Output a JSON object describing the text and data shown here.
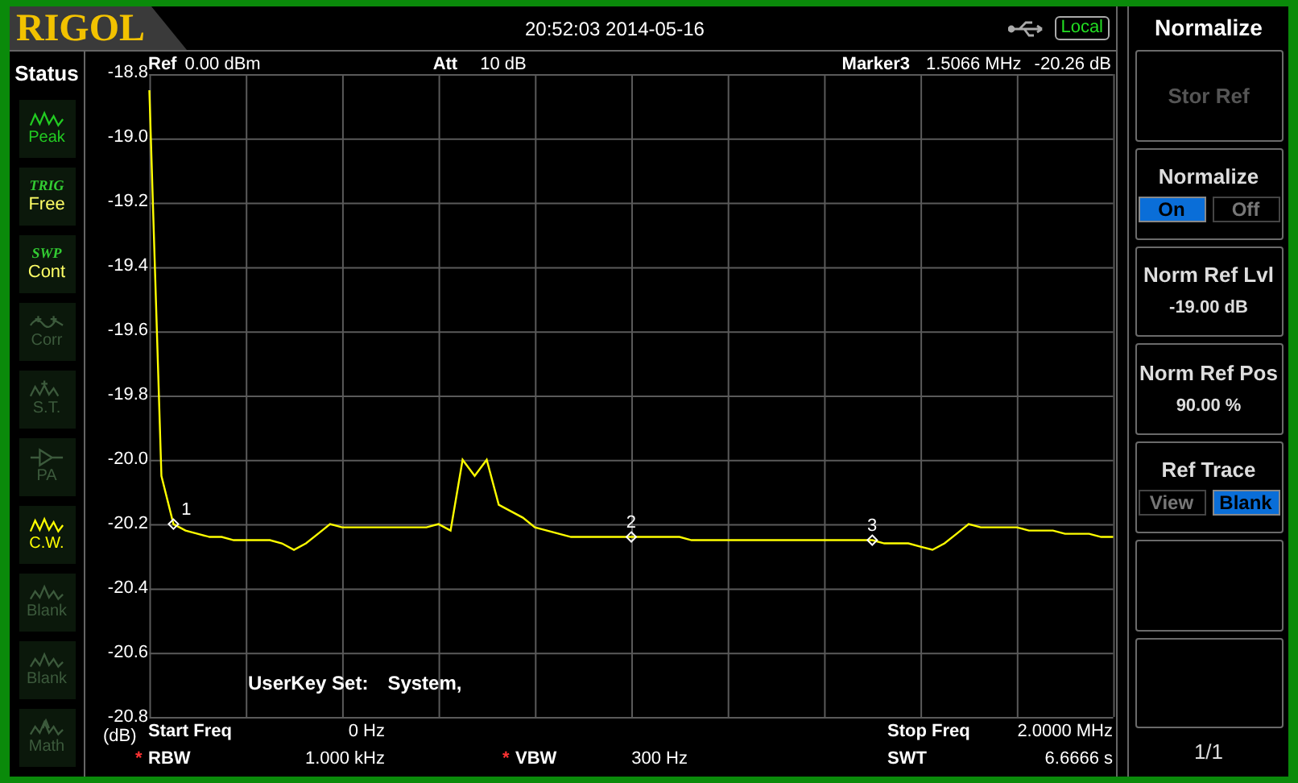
{
  "header": {
    "logo": "RIGOL",
    "datetime": "20:52:03 2014-05-16",
    "remote_badge": "Local"
  },
  "status_panel": {
    "title": "Status",
    "items": [
      {
        "kind": "icon",
        "label": "Peak",
        "disabled": false,
        "selected": false
      },
      {
        "kind": "text",
        "heading": "TRIG",
        "value": "Free"
      },
      {
        "kind": "text",
        "heading": "SWP",
        "value": "Cont"
      },
      {
        "kind": "icon",
        "label": "Corr",
        "disabled": true,
        "selected": false
      },
      {
        "kind": "icon",
        "label": "S.T.",
        "disabled": true,
        "selected": false
      },
      {
        "kind": "icon",
        "label": "PA",
        "disabled": true,
        "selected": false
      },
      {
        "kind": "icon",
        "label": "C.W.",
        "disabled": false,
        "selected": true
      },
      {
        "kind": "icon",
        "label": "Blank",
        "disabled": true,
        "selected": false
      },
      {
        "kind": "icon",
        "label": "Blank",
        "disabled": true,
        "selected": false
      },
      {
        "kind": "icon",
        "label": "Math",
        "disabled": true,
        "selected": false
      }
    ]
  },
  "trace_header": {
    "ref_label": "Ref",
    "ref_value": "0.00 dBm",
    "att_label": "Att",
    "att_value": "10 dB",
    "marker_label": "Marker3",
    "marker_freq": "1.5066 MHz",
    "marker_level": "-20.26 dB"
  },
  "plot": {
    "userkey_label": "UserKey Set:",
    "userkey_value": "System,",
    "markers": [
      {
        "text": "1"
      },
      {
        "text": "2"
      },
      {
        "text": "3"
      }
    ],
    "chart_data": {
      "type": "line",
      "ylabel": "(dB)",
      "grid": true,
      "ylim": [
        -20.8,
        -18.8
      ],
      "yticks": [
        {
          "value": -18.8,
          "label": "-18.8"
        },
        {
          "value": -19,
          "label": "-19.0"
        },
        {
          "value": -19.2,
          "label": "-19.2"
        },
        {
          "value": -19.4,
          "label": "-19.4"
        },
        {
          "value": -19.6,
          "label": "-19.6"
        },
        {
          "value": -19.8,
          "label": "-19.8"
        },
        {
          "value": -20,
          "label": "-20.0"
        },
        {
          "value": -20.2,
          "label": "-20.2"
        },
        {
          "value": -20.4,
          "label": "-20.4"
        },
        {
          "value": -20.6,
          "label": "-20.6"
        },
        {
          "value": -20.8,
          "label": "-20.8"
        }
      ],
      "categories": [
        null,
        null,
        null,
        null,
        null,
        null,
        null,
        null,
        null,
        null,
        null,
        null,
        null,
        null,
        null,
        null,
        null,
        null,
        null,
        null,
        null,
        null,
        null,
        null,
        null,
        null,
        null,
        null,
        null,
        null,
        null,
        null,
        null,
        null,
        null,
        null,
        null,
        null,
        null,
        null,
        null,
        null,
        null,
        null,
        null,
        null,
        null,
        null,
        null,
        null,
        null,
        null,
        null,
        null,
        null,
        null,
        null,
        null,
        null,
        null,
        null,
        null,
        null,
        null,
        null,
        null,
        null,
        null,
        null,
        null,
        null,
        null,
        null,
        null,
        null,
        null,
        null,
        null,
        null,
        null,
        null
      ],
      "series": [
        {
          "color": "#ffff00",
          "values": [
            -18.85,
            -20.05,
            -20.2,
            -20.22,
            -20.23,
            -20.24,
            -20.24,
            -20.25,
            -20.25,
            -20.25,
            -20.25,
            -20.26,
            -20.28,
            -20.26,
            -20.23,
            -20.2,
            -20.21,
            -20.21,
            -20.21,
            -20.21,
            -20.21,
            -20.21,
            -20.21,
            -20.21,
            -20.2,
            -20.22,
            -20.0,
            -20.05,
            -20.0,
            -20.14,
            -20.16,
            -20.18,
            -20.21,
            -20.22,
            -20.23,
            -20.24,
            -20.24,
            -20.24,
            -20.24,
            -20.24,
            -20.24,
            -20.24,
            -20.24,
            -20.24,
            -20.24,
            -20.25,
            -20.25,
            -20.25,
            -20.25,
            -20.25,
            -20.25,
            -20.25,
            -20.25,
            -20.25,
            -20.25,
            -20.25,
            -20.25,
            -20.25,
            -20.25,
            -20.25,
            -20.25,
            -20.26,
            -20.26,
            -20.26,
            -20.27,
            -20.28,
            -20.26,
            -20.23,
            -20.2,
            -20.21,
            -20.21,
            -20.21,
            -20.21,
            -20.22,
            -20.22,
            -20.22,
            -20.23,
            -20.23,
            -20.23,
            -20.24,
            -20.24
          ]
        }
      ]
    }
  },
  "footer": {
    "rows": [
      [
        {
          "label": "Start Freq",
          "value": "0 Hz"
        },
        "",
        {
          "label": "Stop Freq",
          "value": "2.0000 MHz"
        }
      ],
      [
        {
          "flag": "*",
          "label": "RBW",
          "value": "1.000 kHz"
        },
        {
          "flag": "*",
          "label": "VBW",
          "value": "300 Hz"
        },
        {
          "label": "SWT",
          "value": "6.6666 s"
        }
      ]
    ]
  },
  "softkey_menu": {
    "title": "Normalize",
    "keys": [
      {
        "kind": "label",
        "label": "Stor Ref",
        "disabled": true
      },
      {
        "kind": "toggle",
        "label": "Normalize",
        "options": [
          {
            "label": "On",
            "selected": true
          },
          {
            "label": "Off",
            "selected": false
          }
        ]
      },
      {
        "kind": "value",
        "label": "Norm Ref Lvl",
        "value": "-19.00 dB"
      },
      {
        "kind": "value",
        "label": "Norm Ref Pos",
        "value": "90.00 %"
      },
      {
        "kind": "toggle",
        "label": "Ref Trace",
        "options": [
          {
            "label": "View",
            "selected": false
          },
          {
            "label": "Blank",
            "selected": true
          }
        ]
      },
      {
        "kind": "empty"
      },
      {
        "kind": "empty"
      }
    ],
    "page": "1/1"
  }
}
